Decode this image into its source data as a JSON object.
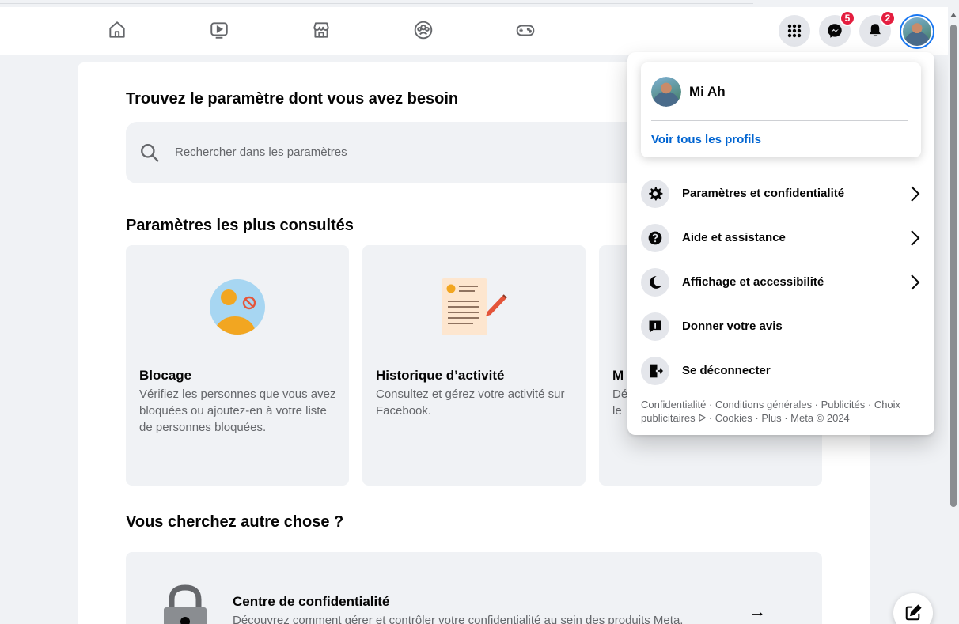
{
  "header": {
    "nav": [
      {
        "name": "home-icon"
      },
      {
        "name": "video-icon"
      },
      {
        "name": "marketplace-icon"
      },
      {
        "name": "groups-icon"
      },
      {
        "name": "gaming-icon"
      }
    ],
    "menu_icon": "grid-menu-icon",
    "messenger": {
      "icon": "messenger-icon",
      "badge": "5"
    },
    "notifications": {
      "icon": "bell-icon",
      "badge": "2"
    },
    "account_icon": "avatar"
  },
  "main": {
    "search_title": "Trouvez le paramètre dont vous avez besoin",
    "search_placeholder": "Rechercher dans les paramètres",
    "popular_title": "Paramètres les plus consultés",
    "tiles": [
      {
        "title": "Blocage",
        "desc": "Vérifiez les personnes que vous avez bloquées ou ajoutez-en à votre liste de personnes bloquées."
      },
      {
        "title": "Historique d’activité",
        "desc": "Consultez et gérez votre activité sur Facebook."
      },
      {
        "title": "M",
        "desc": "Dé le"
      }
    ],
    "other_title": "Vous cherchez autre chose ?",
    "privacy": {
      "title": "Centre de confidentialité",
      "desc": "Découvrez comment gérer et contrôler votre confidentialité au sein des produits Meta.",
      "arrow": "→"
    }
  },
  "dropdown": {
    "profile_name": "Mi Ah",
    "see_all_profiles": "Voir tous les profils",
    "items": [
      {
        "label": "Paramètres et confidentialité",
        "icon": "gear-icon",
        "chevron": true
      },
      {
        "label": "Aide et assistance",
        "icon": "help-icon",
        "chevron": true
      },
      {
        "label": "Affichage et accessibilité",
        "icon": "moon-icon",
        "chevron": true
      },
      {
        "label": "Donner votre avis",
        "icon": "feedback-icon",
        "chevron": false
      },
      {
        "label": "Se déconnecter",
        "icon": "logout-icon",
        "chevron": false
      }
    ],
    "footer": "Confidentialité · Conditions générales · Publicités · Choix publicitaires ᐅ · Cookies · Plus · Meta © 2024"
  },
  "colors": {
    "accent": "#1877f2",
    "link": "#0064d1",
    "badge": "#e41e3f",
    "surface": "#f0f2f5"
  }
}
